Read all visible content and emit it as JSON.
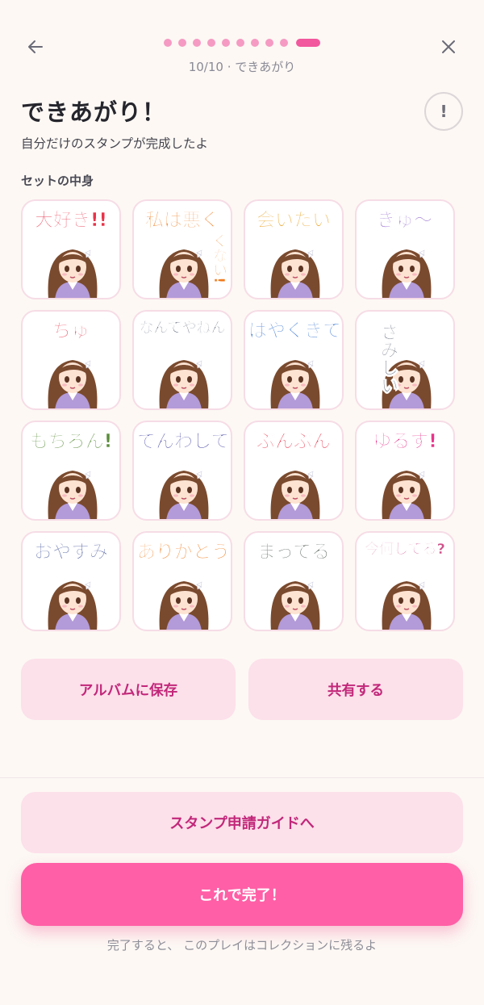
{
  "header": {
    "back_icon": "arrow-left-icon",
    "close_icon": "close-icon",
    "progress": {
      "current": 10,
      "total": 10
    },
    "step_label": "10/10 · できあがり"
  },
  "title": "できあがり！",
  "help_label": "!",
  "subtitle": "自分だけのスタンプが完成したよ",
  "section_label": "セットの中身",
  "stickers": [
    {
      "text": "大好き!!",
      "color": "#e8334a"
    },
    {
      "text": "私は悪く",
      "text2": "くない!",
      "color": "#f07a1c"
    },
    {
      "text": "会いたい",
      "color": "#e8a020"
    },
    {
      "text": "ぎゅ〜",
      "color": "#8a5bc8"
    },
    {
      "text": "ちゅ",
      "color": "#e8334a"
    },
    {
      "text": "なんでやねん",
      "color": "#1f2a44"
    },
    {
      "text": "はやくきて",
      "color": "#2f6fd0"
    },
    {
      "text": "さみしい",
      "color": "#555e6e"
    },
    {
      "text": "もちろん!",
      "color": "#5a8c3a"
    },
    {
      "text": "でんわして",
      "color": "#4b4ba8"
    },
    {
      "text": "ぷんぷん",
      "color": "#e8334a"
    },
    {
      "text": "ゆるす!",
      "color": "#e8338a"
    },
    {
      "text": "おやすみ",
      "color": "#2a3d8c"
    },
    {
      "text": "ありがとう",
      "color": "#f07a1c"
    },
    {
      "text": "まってる",
      "color": "#4f5a52"
    },
    {
      "text": "今何してる?",
      "color": "#d0508a"
    }
  ],
  "actions": {
    "save_label": "アルバムに保存",
    "share_label": "共有する"
  },
  "guide_label": "スタンプ申請ガイドへ",
  "done_label": "これで完了！",
  "footnote": "完了すると、 このプレイはコレクションに残るよ",
  "colors": {
    "accent": "#ff5fa6",
    "accent_soft": "#fce0ea",
    "accent_text": "#c2277a",
    "background": "#fdf8f4"
  }
}
